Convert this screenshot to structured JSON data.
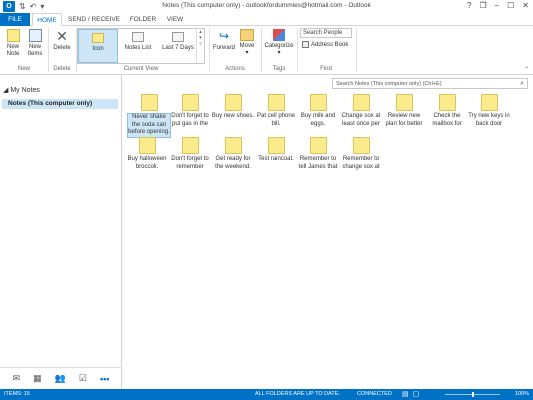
{
  "window": {
    "title": "Notes (This computer only) - outlookfordummies@hotmail.com - Outlook",
    "help": "?",
    "restore_down": "❐",
    "minimize": "–",
    "maximize": "☐",
    "close": "✕"
  },
  "ribbon_tabs": [
    {
      "label": "FILE"
    },
    {
      "label": "HOME"
    },
    {
      "label": "SEND / RECEIVE"
    },
    {
      "label": "FOLDER"
    },
    {
      "label": "VIEW"
    }
  ],
  "ribbon": {
    "new_note": "New Note",
    "new_items": "New Items",
    "new_group": "New",
    "delete": "Delete",
    "delete_group": "Delete",
    "view_icon": "Icon",
    "view_notes_list": "Notes List",
    "view_last7": "Last 7 Days",
    "current_view_group": "Current View",
    "forward": "Forward",
    "move": "Move",
    "actions_group": "Actions",
    "categorize": "Categorize",
    "tags_group": "Tags",
    "search_people_placeholder": "Search People",
    "address_book": "Address Book",
    "find_group": "Find"
  },
  "search_notes_placeholder": "Search Notes (This computer only) (Ctrl+E)",
  "nav": {
    "heading": "My Notes",
    "selected_folder": "Notes (This computer only)"
  },
  "notes": [
    {
      "text": "Never shake the soda can before opening."
    },
    {
      "text": "Don't forget to put gas in the"
    },
    {
      "text": "Buy new shoes."
    },
    {
      "text": "Pat cell phone bill."
    },
    {
      "text": "Buy milk and eggs."
    },
    {
      "text": "Change sox at least once per"
    },
    {
      "text": "Review new plan for better"
    },
    {
      "text": "Check the mailbox for"
    },
    {
      "text": "Try new keys in back door"
    },
    {
      "text": "Buy halloween broccoli."
    },
    {
      "text": "Don't forget to remember"
    },
    {
      "text": "Get ready for the weekend."
    },
    {
      "text": "Test raincoat."
    },
    {
      "text": "Remember to tell James that"
    },
    {
      "text": "Remember to change sox at"
    }
  ],
  "status": {
    "items": "ITEMS: 15",
    "sync": "ALL FOLDERS ARE UP TO DATE.",
    "connection": "CONNECTED",
    "zoom": "100%"
  },
  "colors": {
    "accent": "#0072c6",
    "sticky": "#fbeb8c",
    "selection": "#cde6f7"
  }
}
